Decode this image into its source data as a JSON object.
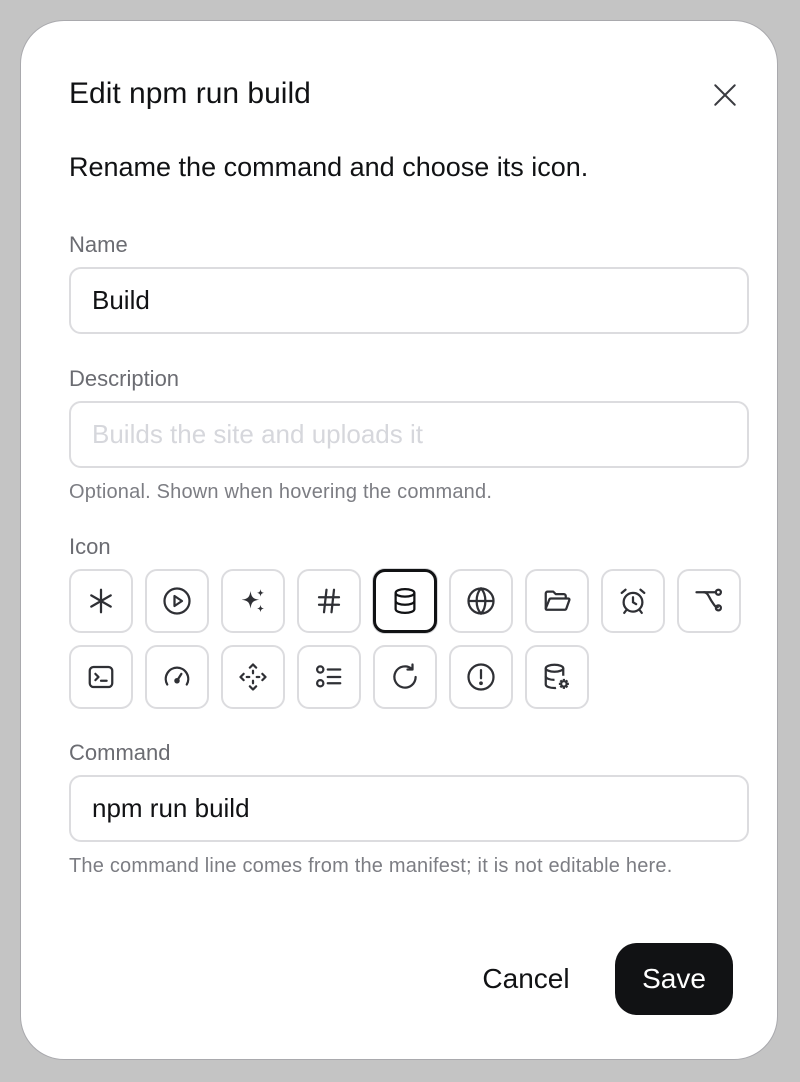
{
  "dialog": {
    "title": "Edit npm run build",
    "subtitle": "Rename the command and choose its icon.",
    "close_icon": "close-icon"
  },
  "name": {
    "label": "Name",
    "value": "Build"
  },
  "description": {
    "label": "Description",
    "value": "",
    "placeholder": "Builds the site and uploads it",
    "hint": "Optional. Shown when hovering the command."
  },
  "icon_picker": {
    "label": "Icon",
    "selected": "database-icon",
    "icons": [
      "asterisk-icon",
      "play-circle-icon",
      "sparkles-icon",
      "hash-icon",
      "database-icon",
      "globe-icon",
      "folder-open-icon",
      "alarm-clock-icon",
      "git-branch-icon",
      "terminal-icon",
      "gauge-icon",
      "move-icon",
      "list-todo-icon",
      "refresh-icon",
      "alert-circle-icon",
      "database-settings-icon"
    ]
  },
  "command": {
    "label": "Command",
    "value": "npm run build",
    "hint": "The command line comes from the manifest; it is not editable here."
  },
  "actions": {
    "cancel_label": "Cancel",
    "save_label": "Save"
  },
  "colors": {
    "primary": "#111214",
    "border": "#dcdcdf",
    "muted_text": "#6b6c72",
    "placeholder": "#d6d7dc"
  }
}
